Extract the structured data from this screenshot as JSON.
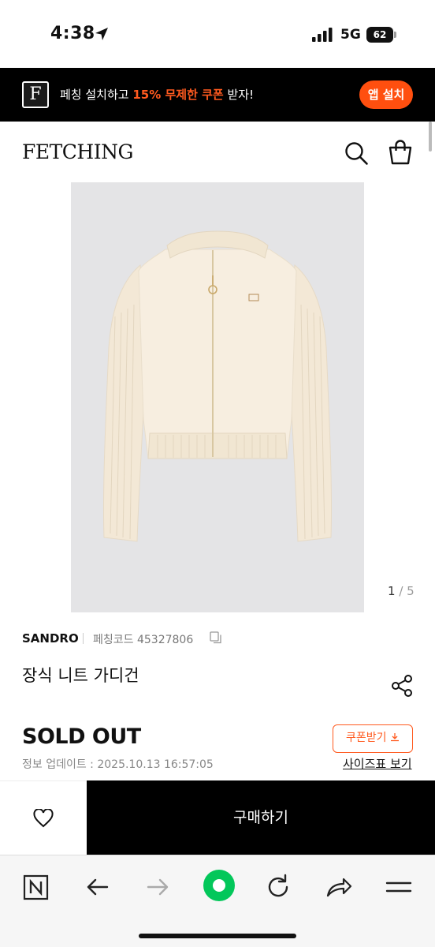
{
  "status_bar": {
    "time": "4:38",
    "network": "5G",
    "battery": "62"
  },
  "app_banner": {
    "logo_letter": "F",
    "text_before": "페칭 설치하고 ",
    "highlight": "15% 무제한 쿠폰",
    "text_after": " 받자!",
    "install_label": "앱 설치",
    "accent_color": "#ff4f0f"
  },
  "header": {
    "logo": "FETCHING",
    "icons": [
      "search-icon",
      "shopping-bag-icon"
    ]
  },
  "gallery": {
    "current": "1",
    "separator": "/",
    "total": "5"
  },
  "product": {
    "brand": "SANDRO",
    "code_label": "페칭코드 45327806",
    "name": "장식 니트 가디건",
    "status": "SOLD OUT",
    "coupon_label": "쿠폰받기",
    "updated_label": "정보 업데이트 : 2025.10.13 16:57:05",
    "size_chart_label": "사이즈표 보기"
  },
  "purchase_bar": {
    "buy_label": "구매하기"
  },
  "browser_toolbar": {
    "icons": [
      "naver-icon",
      "back-arrow-icon",
      "forward-arrow-icon",
      "green-dot-icon",
      "refresh-icon",
      "share-arrow-icon",
      "menu-icon"
    ]
  }
}
